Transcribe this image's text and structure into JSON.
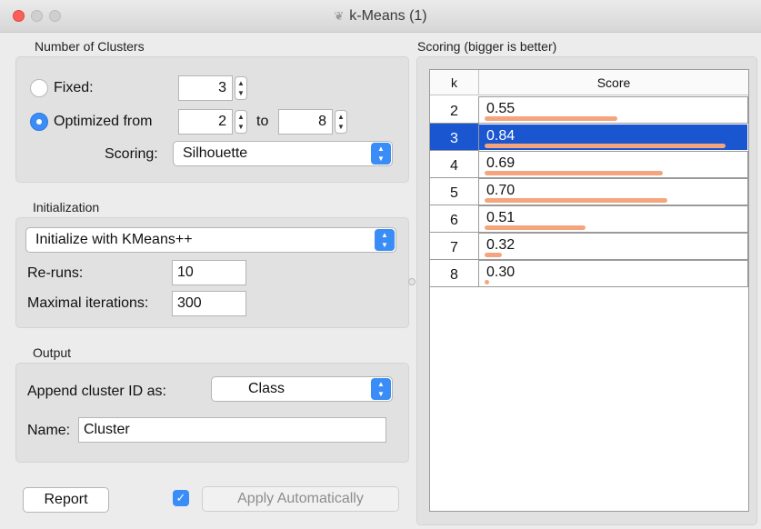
{
  "window": {
    "title": "k-Means (1)",
    "icon": "widget-icon",
    "lights": {
      "close": "#fc5f57",
      "minimize": "#cfcfcf",
      "maximize": "#cfcfcf"
    }
  },
  "clusters": {
    "section_label": "Number of Clusters",
    "fixed_label": "Fixed:",
    "fixed_value": "3",
    "optimized_label": "Optimized from",
    "from_value": "2",
    "to_label": "to",
    "to_value": "8",
    "scoring_label": "Scoring:",
    "scoring_value": "Silhouette",
    "selected_mode": "optimized"
  },
  "initialization": {
    "section_label": "Initialization",
    "method_value": "Initialize with KMeans++",
    "reruns_label": "Re-runs:",
    "reruns_value": "10",
    "maxiter_label": "Maximal iterations:",
    "maxiter_value": "300"
  },
  "output": {
    "section_label": "Output",
    "append_label": "Append cluster ID as:",
    "append_value": "Class",
    "name_label": "Name:",
    "name_value": "Cluster"
  },
  "scoring": {
    "section_label": "Scoring (bigger is better)",
    "columns": [
      "k",
      "Score"
    ],
    "rows": [
      {
        "k": "2",
        "score": "0.55",
        "bar": 0.55
      },
      {
        "k": "3",
        "score": "0.84",
        "bar": 1.0
      },
      {
        "k": "4",
        "score": "0.69",
        "bar": 0.74
      },
      {
        "k": "5",
        "score": "0.70",
        "bar": 0.76
      },
      {
        "k": "6",
        "score": "0.51",
        "bar": 0.42
      },
      {
        "k": "7",
        "score": "0.32",
        "bar": 0.07
      },
      {
        "k": "8",
        "score": "0.30",
        "bar": 0.0
      }
    ],
    "selected_k": "3",
    "bar_color": "#f5a57e",
    "selection_color": "#1a56d0"
  },
  "footer": {
    "report_label": "Report",
    "auto_apply_checked": true,
    "apply_label": "Apply Automatically"
  }
}
